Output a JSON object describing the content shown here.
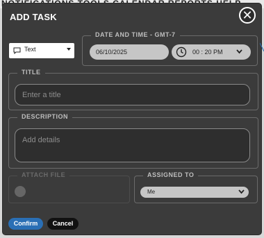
{
  "background": {
    "menu_text": "NOTIFICATIONS  TOOLS  CALENDAR  REPORTS  HELP"
  },
  "dialog": {
    "title": "ADD TASK",
    "close_symbol": "✕",
    "type_select": {
      "value": "Text",
      "icon": "chat-icon"
    },
    "date_time": {
      "legend": "DATE AND TIME - GMT-7",
      "date": "06/10/2025",
      "time": "00 : 20 PM"
    },
    "title_field": {
      "legend": "TITLE",
      "placeholder": "Enter a title"
    },
    "description_field": {
      "legend": "DESCRIPTION",
      "placeholder": "Add details"
    },
    "attach_file": {
      "legend": "ATTACH FILE",
      "icon": "paperclip-icon"
    },
    "assigned_to": {
      "legend": "ASSIGNED TO",
      "value": "Me"
    },
    "buttons": {
      "confirm": "Confirm",
      "cancel": "Cancel"
    }
  },
  "colors": {
    "dialog_bg": "#3b3b3b",
    "confirm": "#2a6fb5",
    "cancel": "#111111",
    "field": "#c6c6c6"
  }
}
